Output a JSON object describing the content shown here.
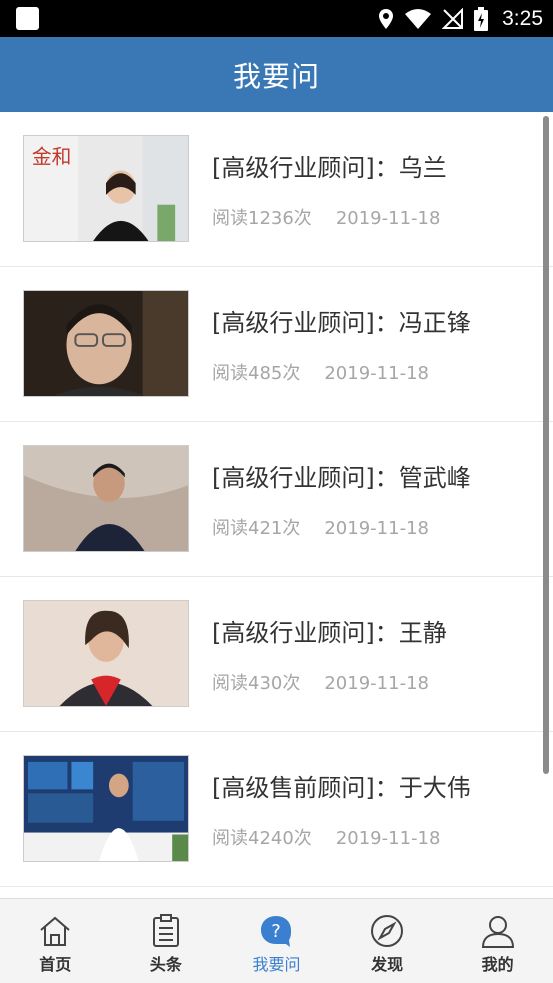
{
  "status_bar": {
    "time": "3:25"
  },
  "header": {
    "title": "我要问"
  },
  "items": [
    {
      "title": "[高级行业顾问]：乌兰",
      "reads": "阅读1236次",
      "date": "2019-11-18"
    },
    {
      "title": "[高级行业顾问]：冯正锋",
      "reads": "阅读485次",
      "date": "2019-11-18"
    },
    {
      "title": "[高级行业顾问]：管武峰",
      "reads": "阅读421次",
      "date": "2019-11-18"
    },
    {
      "title": "[高级行业顾问]：王静",
      "reads": "阅读430次",
      "date": "2019-11-18"
    },
    {
      "title": "[高级售前顾问]：于大伟",
      "reads": "阅读4240次",
      "date": "2019-11-18"
    }
  ],
  "tabs": [
    {
      "label": "首页",
      "icon": "home-icon"
    },
    {
      "label": "头条",
      "icon": "clipboard-icon"
    },
    {
      "label": "我要问",
      "icon": "question-icon",
      "active": true
    },
    {
      "label": "发现",
      "icon": "compass-icon"
    },
    {
      "label": "我的",
      "icon": "user-icon"
    }
  ],
  "colors": {
    "header": "#3a78b5",
    "active_tab": "#3a7fd0"
  }
}
